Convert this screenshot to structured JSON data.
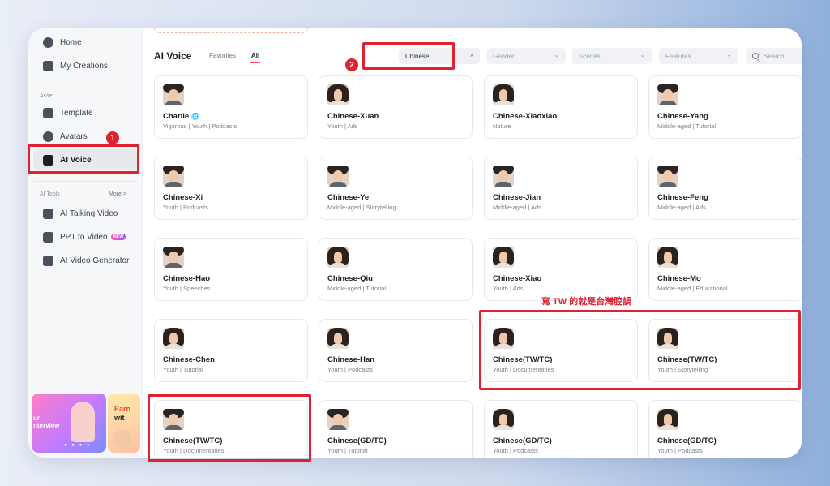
{
  "sidebar": {
    "nav_top": [
      {
        "label": "Home",
        "icon": "home-icon"
      },
      {
        "label": "My Creations",
        "icon": "folder-icon"
      }
    ],
    "asset_label": "Asset",
    "asset_items": [
      {
        "label": "Template",
        "icon": "template-icon"
      },
      {
        "label": "Avatars",
        "icon": "avatar-icon"
      },
      {
        "label": "AI Voice",
        "icon": "voice-icon"
      }
    ],
    "tools_label": "AI Tools",
    "more_label": "More >",
    "tool_items": [
      {
        "label": "AI Talking Video",
        "icon": "talking-video-icon"
      },
      {
        "label": "PPT to Video",
        "icon": "ppt-icon",
        "badge": "NEW"
      },
      {
        "label": "AI Video Generator",
        "icon": "video-generator-icon"
      }
    ],
    "promo": {
      "text": "ur\nnterview",
      "dots": "● ● ● ●"
    },
    "promo2": {
      "text_a": "Earn",
      "text_b": "wit"
    }
  },
  "main": {
    "title": "AI Voice",
    "tabs": [
      {
        "label": "Favorites"
      },
      {
        "label": "All"
      }
    ],
    "filters": {
      "language_chip": "Chinese",
      "chip_close": "×",
      "gender_placeholder": "Gender",
      "scenes_placeholder": "Scenes",
      "features_placeholder": "Features",
      "search_placeholder": "Search",
      "chevron": "⌄"
    },
    "globe_glyph": "🌐",
    "cards": [
      {
        "name": "Charlie",
        "tags": "Vigorous | Youth | Podcasts",
        "gender": "m",
        "globe": true
      },
      {
        "name": "Chinese-Xuan",
        "tags": "Youth | Ads",
        "gender": "f"
      },
      {
        "name": "Chinese-Xiaoxiao",
        "tags": "Nature",
        "gender": "f"
      },
      {
        "name": "Chinese-Yang",
        "tags": "Middle-aged | Tutorial",
        "gender": "m"
      },
      {
        "name": "Chinese-Xi",
        "tags": "Youth | Podcasts",
        "gender": "m"
      },
      {
        "name": "Chinese-Ye",
        "tags": "Middle-aged | Storytelling",
        "gender": "m"
      },
      {
        "name": "Chinese-Jian",
        "tags": "Middle-aged | Ads",
        "gender": "m"
      },
      {
        "name": "Chinese-Feng",
        "tags": "Middle-aged | Ads",
        "gender": "m"
      },
      {
        "name": "Chinese-Hao",
        "tags": "Youth | Speeches",
        "gender": "m"
      },
      {
        "name": "Chinese-Qiu",
        "tags": "Middle-aged | Tutorial",
        "gender": "f"
      },
      {
        "name": "Chinese-Xiao",
        "tags": "Youth | Ads",
        "gender": "f"
      },
      {
        "name": "Chinese-Mo",
        "tags": "Middle-aged | Educational",
        "gender": "f"
      },
      {
        "name": "Chinese-Chen",
        "tags": "Youth | Tutorial",
        "gender": "f"
      },
      {
        "name": "Chinese-Han",
        "tags": "Youth | Podcasts",
        "gender": "f"
      },
      {
        "name": "Chinese(TW/TC)",
        "tags": "Youth | Documentaries",
        "gender": "f"
      },
      {
        "name": "Chinese(TW/TC)",
        "tags": "Youth | Storytelling",
        "gender": "f"
      },
      {
        "name": "Chinese(TW/TC)",
        "tags": "Youth | Documentaries",
        "gender": "m"
      },
      {
        "name": "Chinese(GD/TC)",
        "tags": "Youth | Tutorial",
        "gender": "m"
      },
      {
        "name": "Chinese(GD/TC)",
        "tags": "Youth | Podcasts",
        "gender": "f"
      },
      {
        "name": "Chinese(GD/TC)",
        "tags": "Youth | Podcasts",
        "gender": "f"
      }
    ]
  },
  "annotations": {
    "step1": "1",
    "step2": "2",
    "note": "寫 TW 的就是台灣腔調",
    "color": "#e0212f"
  }
}
